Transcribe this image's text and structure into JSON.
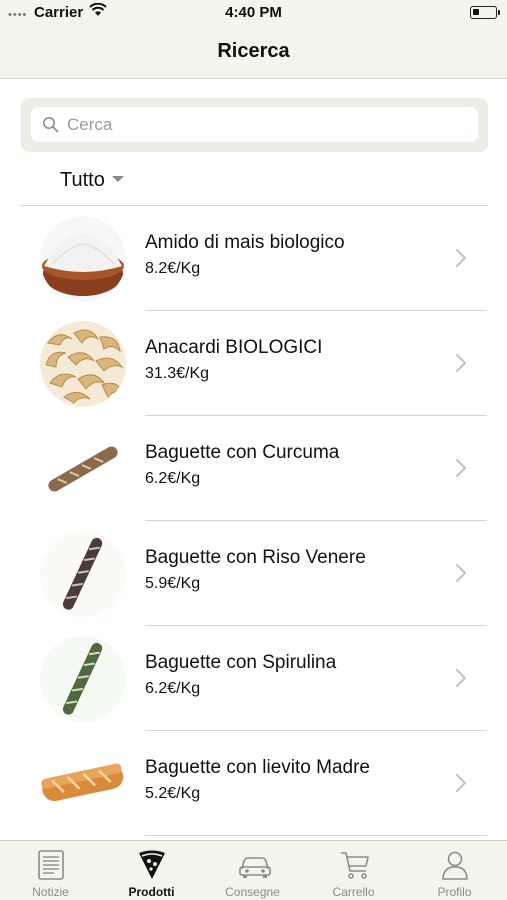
{
  "status_bar": {
    "carrier": "Carrier",
    "time": "4:40 PM"
  },
  "nav": {
    "title": "Ricerca"
  },
  "search": {
    "placeholder": "Cerca",
    "value": "",
    "icon": "search-icon"
  },
  "filter": {
    "label": "Tutto"
  },
  "products": [
    {
      "name": "Amido di mais biologico",
      "price": "8.2€/Kg",
      "image": "cornstarch-bowl"
    },
    {
      "name": "Anacardi BIOLOGICI",
      "price": "31.3€/Kg",
      "image": "cashews"
    },
    {
      "name": "Baguette con Curcuma",
      "price": "6.2€/Kg",
      "image": "baguette-curcuma"
    },
    {
      "name": "Baguette con Riso Venere",
      "price": "5.9€/Kg",
      "image": "baguette-riso-venere"
    },
    {
      "name": "Baguette con Spirulina",
      "price": "6.2€/Kg",
      "image": "baguette-spirulina"
    },
    {
      "name": "Baguette con lievito Madre",
      "price": "5.2€/Kg",
      "image": "baguette-lievito-madre"
    }
  ],
  "tabbar": {
    "items": [
      {
        "label": "Notizie",
        "icon": "news-icon"
      },
      {
        "label": "Prodotti",
        "icon": "pizza-slice-icon",
        "active": true
      },
      {
        "label": "Consegne",
        "icon": "car-icon"
      },
      {
        "label": "Carrello",
        "icon": "cart-icon"
      },
      {
        "label": "Profilo",
        "icon": "profile-icon"
      }
    ]
  },
  "colors": {
    "bar_background": "#f4f3ec",
    "inactive_tab": "#8b8b8b",
    "separator": "#d3d3d3"
  }
}
